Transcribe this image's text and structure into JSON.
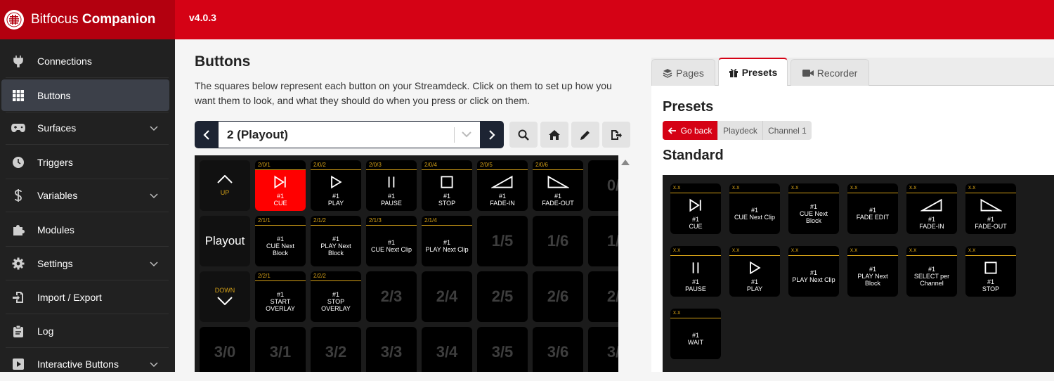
{
  "app": {
    "brand_light": "Bitfocus ",
    "brand_bold": "Companion",
    "version": "v4.0.3"
  },
  "sidebar": {
    "items": [
      {
        "label": "Connections",
        "icon": "plug-icon"
      },
      {
        "label": "Buttons",
        "icon": "grid-icon",
        "active": true
      },
      {
        "label": "Surfaces",
        "icon": "gamepad-icon",
        "expandable": true
      },
      {
        "label": "Triggers",
        "icon": "clock-icon"
      },
      {
        "label": "Variables",
        "icon": "dollar-icon",
        "expandable": true
      },
      {
        "label": "Modules",
        "icon": "puzzle-icon"
      },
      {
        "label": "Settings",
        "icon": "gear-icon",
        "expandable": true
      },
      {
        "label": "Import / Export",
        "icon": "file-import-icon"
      },
      {
        "label": "Log",
        "icon": "clipboard-icon"
      },
      {
        "label": "Interactive Buttons",
        "icon": "play-square-icon",
        "expandable": true
      }
    ]
  },
  "main": {
    "title": "Buttons",
    "description": "The squares below represent each button on your Streamdeck. Click on them to set up how you want them to look, and what they should do when you press or click on them.",
    "page_select": "2 (Playout)",
    "toolbar": [
      "search-icon",
      "home-icon",
      "pencil-icon",
      "export-icon"
    ]
  },
  "grid": {
    "nav": {
      "up": "UP",
      "page_name": "Playout",
      "down": "DOWN"
    },
    "row0": [
      {
        "hdr": "2/0/1",
        "l1": "#1",
        "l2": "CUE",
        "icon": "cue",
        "red": true
      },
      {
        "hdr": "2/0/2",
        "l1": "#1",
        "l2": "PLAY",
        "icon": "play"
      },
      {
        "hdr": "2/0/3",
        "l1": "#1",
        "l2": "PAUSE",
        "icon": "pause"
      },
      {
        "hdr": "2/0/4",
        "l1": "#1",
        "l2": "STOP",
        "icon": "stop"
      },
      {
        "hdr": "2/0/5",
        "l1": "#1",
        "l2": "FADE-IN",
        "icon": "fadein"
      },
      {
        "hdr": "2/0/6",
        "l1": "#1",
        "l2": "FADE-OUT",
        "icon": "fadeout"
      },
      {
        "empty": "0/"
      }
    ],
    "row1": [
      {
        "hdr": "2/1/1",
        "l1": "#1",
        "l2": "CUE Next",
        "l3": "Block"
      },
      {
        "hdr": "2/1/2",
        "l1": "#1",
        "l2": "PLAY Next",
        "l3": "Block"
      },
      {
        "hdr": "2/1/3",
        "l1": "#1",
        "l2": "CUE Next Clip"
      },
      {
        "hdr": "2/1/4",
        "l1": "#1",
        "l2": "PLAY Next Clip"
      },
      {
        "empty": "1/5"
      },
      {
        "empty": "1/6"
      },
      {
        "empty": "1/"
      }
    ],
    "row2": [
      {
        "hdr": "2/2/1",
        "l1": "#1",
        "l2": "START",
        "l3": "OVERLAY"
      },
      {
        "hdr": "2/2/2",
        "l1": "#1",
        "l2": "STOP",
        "l3": "OVERLAY"
      },
      {
        "empty": "2/3"
      },
      {
        "empty": "2/4"
      },
      {
        "empty": "2/5"
      },
      {
        "empty": "2/6"
      },
      {
        "empty": "2/"
      }
    ],
    "row3": [
      "3/0",
      "3/1",
      "3/2",
      "3/3",
      "3/4",
      "3/5",
      "3/6",
      "3/"
    ]
  },
  "right": {
    "tabs": [
      {
        "label": "Pages",
        "icon": "layers-icon"
      },
      {
        "label": "Presets",
        "icon": "gift-icon",
        "active": true
      },
      {
        "label": "Recorder",
        "icon": "video-icon"
      }
    ],
    "title": "Presets",
    "go_back": "Go back",
    "crumbs": [
      "Playdeck",
      "Channel 1"
    ],
    "section": "Standard",
    "presets": [
      {
        "hdr": "x.x",
        "l1": "#1",
        "l2": "CUE",
        "icon": "cue"
      },
      {
        "hdr": "x.x",
        "l1": "#1",
        "l2": "CUE Next Clip"
      },
      {
        "hdr": "x.x",
        "l1": "#1",
        "l2": "CUE Next",
        "l3": "Block"
      },
      {
        "hdr": "x.x",
        "l1": "#1",
        "l2": "FADE EDIT"
      },
      {
        "hdr": "x.x",
        "l1": "#1",
        "l2": "FADE-IN",
        "icon": "fadein"
      },
      {
        "hdr": "x.x",
        "l1": "#1",
        "l2": "FADE-OUT",
        "icon": "fadeout"
      },
      {
        "hdr": "x.x",
        "l1": "#1",
        "l2": "PAUSE",
        "icon": "pause"
      },
      {
        "hdr": "x.x",
        "l1": "#1",
        "l2": "PLAY",
        "icon": "play"
      },
      {
        "hdr": "x.x",
        "l1": "#1",
        "l2": "PLAY Next Clip"
      },
      {
        "hdr": "x.x",
        "l1": "#1",
        "l2": "PLAY Next",
        "l3": "Block"
      },
      {
        "hdr": "x.x",
        "l1": "#1",
        "l2": "SELECT per",
        "l3": "Channel"
      },
      {
        "hdr": "x.x",
        "l1": "#1",
        "l2": "STOP",
        "icon": "stop"
      },
      {
        "hdr": "x.x",
        "l1": "#1",
        "l2": "WAIT"
      }
    ]
  },
  "colors": {
    "accent": "#d50215",
    "sidebar": "#212121",
    "grid_bg": "#1b1b1b",
    "header_gold": "#d4a017",
    "active_red": "#ff0000"
  }
}
